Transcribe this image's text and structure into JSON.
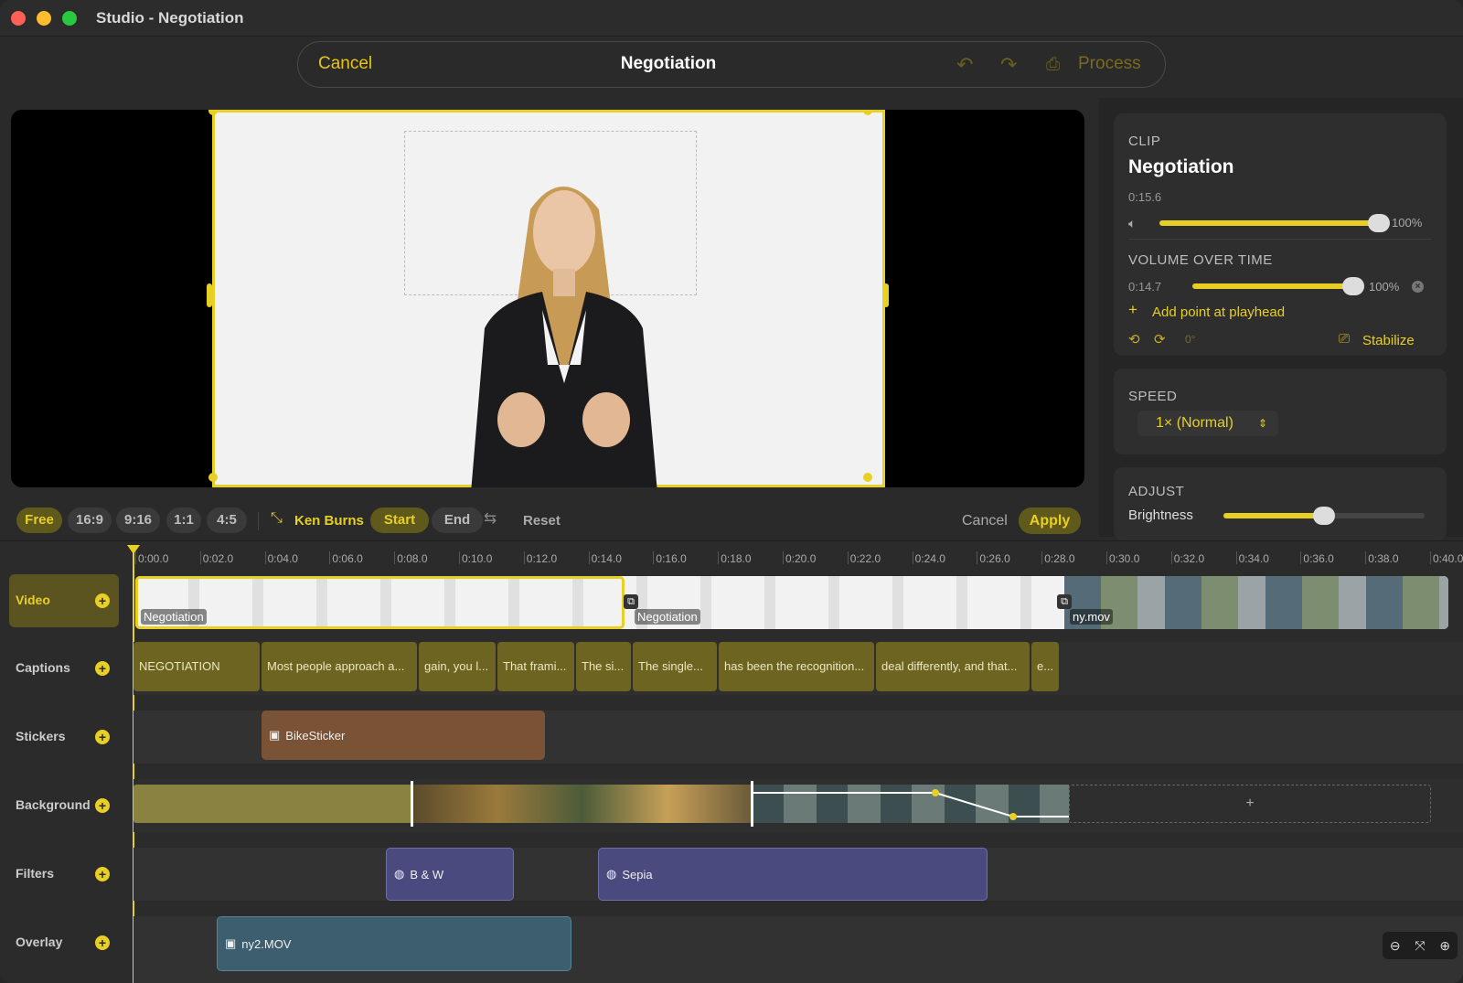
{
  "window": {
    "title": "Studio - Negotiation"
  },
  "header": {
    "cancel_label": "Cancel",
    "title": "Negotiation",
    "process_label": "Process"
  },
  "clip_panel": {
    "section": "CLIP",
    "name": "Negotiation",
    "duration": "0:15.6",
    "volume_pct_text": "100%",
    "volume_fraction": 1.0
  },
  "volume_over_time": {
    "section": "VOLUME OVER TIME",
    "time": "0:14.7",
    "pct_text": "100%",
    "fraction": 1.0,
    "add_point_label": "Add point at playhead",
    "rotation": "0°",
    "stabilize_label": "Stabilize"
  },
  "speed": {
    "section": "SPEED",
    "value": "1× (Normal)"
  },
  "adjust": {
    "section": "ADJUST",
    "brightness_label": "Brightness",
    "brightness_fraction": 0.5
  },
  "crop_bar": {
    "ratios": [
      "Free",
      "16:9",
      "9:16",
      "1:1",
      "4:5"
    ],
    "selected_ratio": "Free",
    "ken_burns": "Ken Burns",
    "start": "Start",
    "end": "End",
    "reset": "Reset",
    "cancel": "Cancel",
    "apply": "Apply"
  },
  "ruler": [
    "0:00.0",
    "0:02.0",
    "0:04.0",
    "0:06.0",
    "0:08.0",
    "0:10.0",
    "0:12.0",
    "0:14.0",
    "0:16.0",
    "0:18.0",
    "0:20.0",
    "0:22.0",
    "0:24.0",
    "0:26.0",
    "0:28.0",
    "0:30.0",
    "0:32.0",
    "0:34.0",
    "0:36.0",
    "0:38.0",
    "0:40.0"
  ],
  "tracks": {
    "video": "Video",
    "captions": "Captions",
    "stickers": "Stickers",
    "background": "Background",
    "filters": "Filters",
    "overlay": "Overlay"
  },
  "video_clips": [
    "Negotiation",
    "Negotiation",
    "ny.mov"
  ],
  "captions": [
    "NEGOTIATION",
    "Most people approach a...",
    "gain, you l...",
    "That frami...",
    "The si...",
    "The single...",
    "has been the recognition...",
    "deal differently, and that...",
    "e..."
  ],
  "sticker": "BikeSticker",
  "background_add": "+",
  "filters": [
    "B & W",
    "Sepia"
  ],
  "overlay": "ny2.MOV",
  "colors": {
    "accent": "#e8cf24",
    "caption": "#6e6422",
    "sticker": "#7a5235",
    "filter": "#4a4a7e",
    "overlay": "#3d5e6e"
  }
}
